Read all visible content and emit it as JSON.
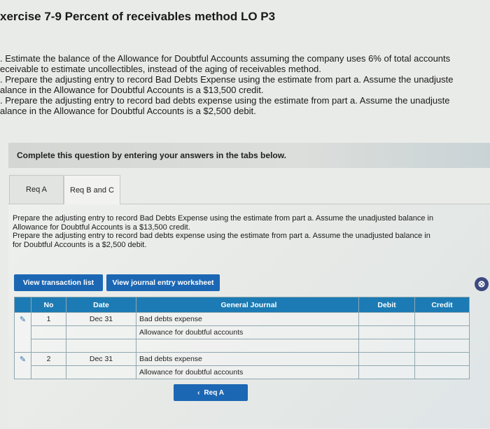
{
  "page": {
    "heading": "xercise 7-9 Percent of receivables method LO P3",
    "instructions": [
      ". Estimate the balance of the Allowance for Doubtful Accounts assuming the company uses 6% of total accounts",
      "eceivable to estimate uncollectibles, instead of the aging of receivables method.",
      ". Prepare the adjusting entry to record Bad Debts Expense using the estimate from part a. Assume the unadjuste",
      "alance in the Allowance for Doubtful Accounts is a $13,500 credit.",
      ". Prepare the adjusting entry to record bad debts expense using the estimate from part a. Assume the unadjuste",
      "alance in the Allowance for Doubtful Accounts is a $2,500 debit."
    ],
    "banner": "Complete this question by entering your answers in the tabs below."
  },
  "tabs": [
    {
      "label": "Req A"
    },
    {
      "label": "Req B and C"
    }
  ],
  "req_text": [
    "Prepare the adjusting entry to record Bad Debts Expense using the estimate from part a. Assume the unadjusted balance in",
    "Allowance for Doubtful Accounts is a $13,500 credit.",
    "Prepare the adjusting entry to record bad debts expense using the estimate from part a. Assume the unadjusted balance in",
    "for Doubtful Accounts is a $2,500 debit."
  ],
  "buttons": {
    "transaction_list": "View transaction list",
    "journal_worksheet": "View journal entry worksheet",
    "prev": "Req A",
    "prev_icon": "‹",
    "close_icon": "⊗"
  },
  "journal": {
    "headers": {
      "no": "No",
      "date": "Date",
      "account": "General Journal",
      "debit": "Debit",
      "credit": "Credit"
    },
    "entries": [
      {
        "no": "1",
        "date": "Dec 31",
        "line1": "Bad debts expense",
        "line2": "Allowance for doubtful accounts"
      },
      {
        "no": "2",
        "date": "Dec 31",
        "line1": "Bad debts expense",
        "line2": "Allowance for doubtful accounts"
      }
    ],
    "edit_icon": "✎"
  }
}
